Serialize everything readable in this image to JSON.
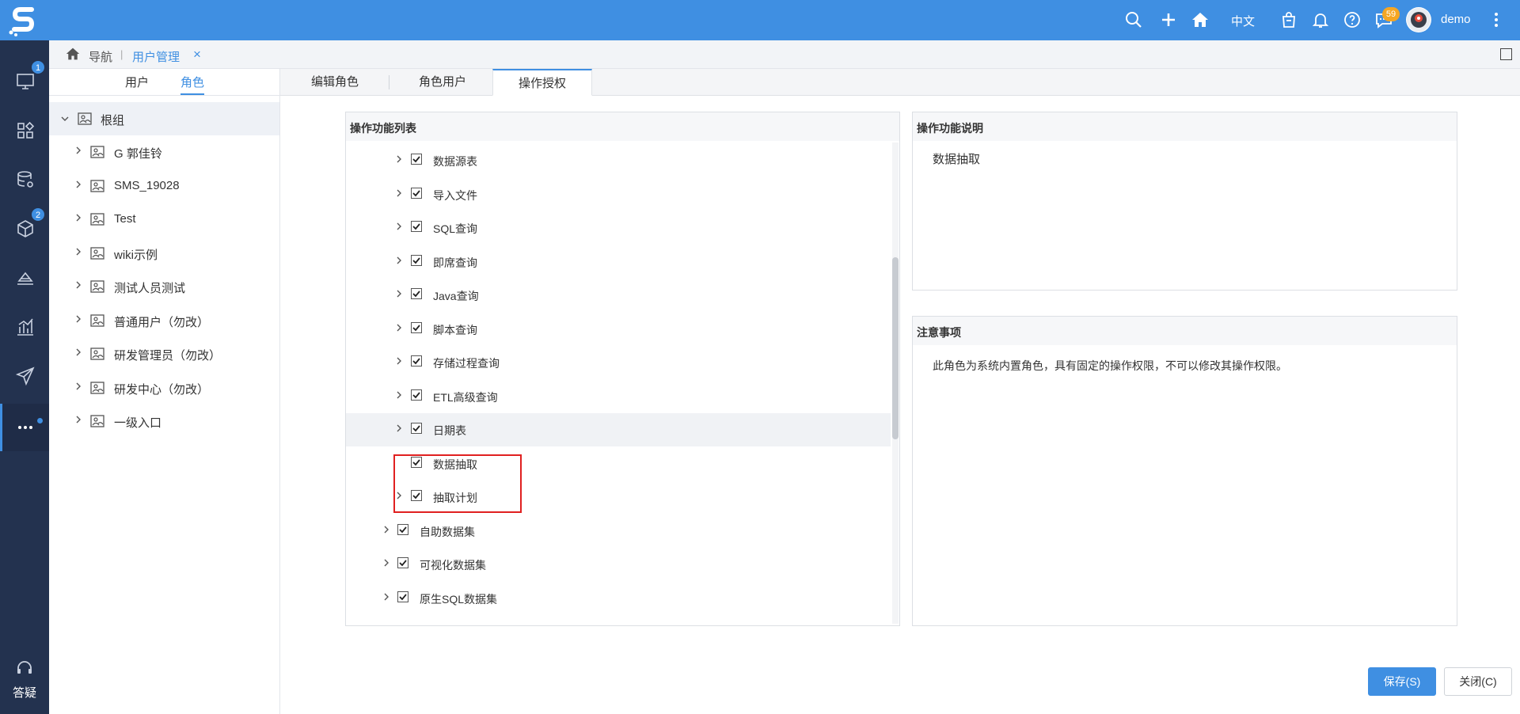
{
  "topbar": {
    "language": "中文",
    "message_badge": "59",
    "username": "demo"
  },
  "leftnav": {
    "badges": {
      "screen": "1",
      "cube": "2"
    },
    "help_label": "答疑"
  },
  "breadcrumb": {
    "home_label": "导航",
    "separator": "|",
    "current_tab": "用户管理",
    "close": "×"
  },
  "rolepanel": {
    "tabs": [
      {
        "label": "用户"
      },
      {
        "label": "角色"
      }
    ],
    "root": "根组",
    "items": [
      {
        "label": "G 郭佳铃"
      },
      {
        "label": "SMS_19028"
      },
      {
        "label": "Test"
      },
      {
        "label": "wiki示例"
      },
      {
        "label": "测试人员测试"
      },
      {
        "label": "普通用户（勿改）"
      },
      {
        "label": "研发管理员（勿改）"
      },
      {
        "label": "研发中心（勿改）"
      },
      {
        "label": "一级入口"
      }
    ]
  },
  "main": {
    "tabs": [
      {
        "label": "编辑角色"
      },
      {
        "label": "角色用户"
      },
      {
        "label": "操作授权"
      }
    ],
    "oplist": {
      "title": "操作功能列表",
      "items": [
        {
          "label": "数据源表",
          "checked": true
        },
        {
          "label": "导入文件",
          "checked": true
        },
        {
          "label": "SQL查询",
          "checked": true
        },
        {
          "label": "即席查询",
          "checked": true
        },
        {
          "label": "Java查询",
          "checked": true
        },
        {
          "label": "脚本查询",
          "checked": true
        },
        {
          "label": "存储过程查询",
          "checked": true
        },
        {
          "label": "ETL高级查询",
          "checked": true
        },
        {
          "label": "日期表",
          "checked": true
        },
        {
          "label": "数据抽取",
          "checked": true
        },
        {
          "label": "抽取计划",
          "checked": true
        },
        {
          "label": "自助数据集",
          "checked": true
        },
        {
          "label": "可视化数据集",
          "checked": true
        },
        {
          "label": "原生SQL数据集",
          "checked": true
        }
      ]
    },
    "description": {
      "title": "操作功能说明",
      "text": "数据抽取"
    },
    "notes": {
      "title": "注意事项",
      "text": "此角色为系统内置角色，具有固定的操作权限，不可以修改其操作权限。"
    },
    "buttons": {
      "save": "保存(S)",
      "close": "关闭(C)"
    }
  },
  "colors": {
    "accent": "#3f8fe2",
    "nav_bg": "#23324f",
    "highlight_border": "#e02020"
  }
}
